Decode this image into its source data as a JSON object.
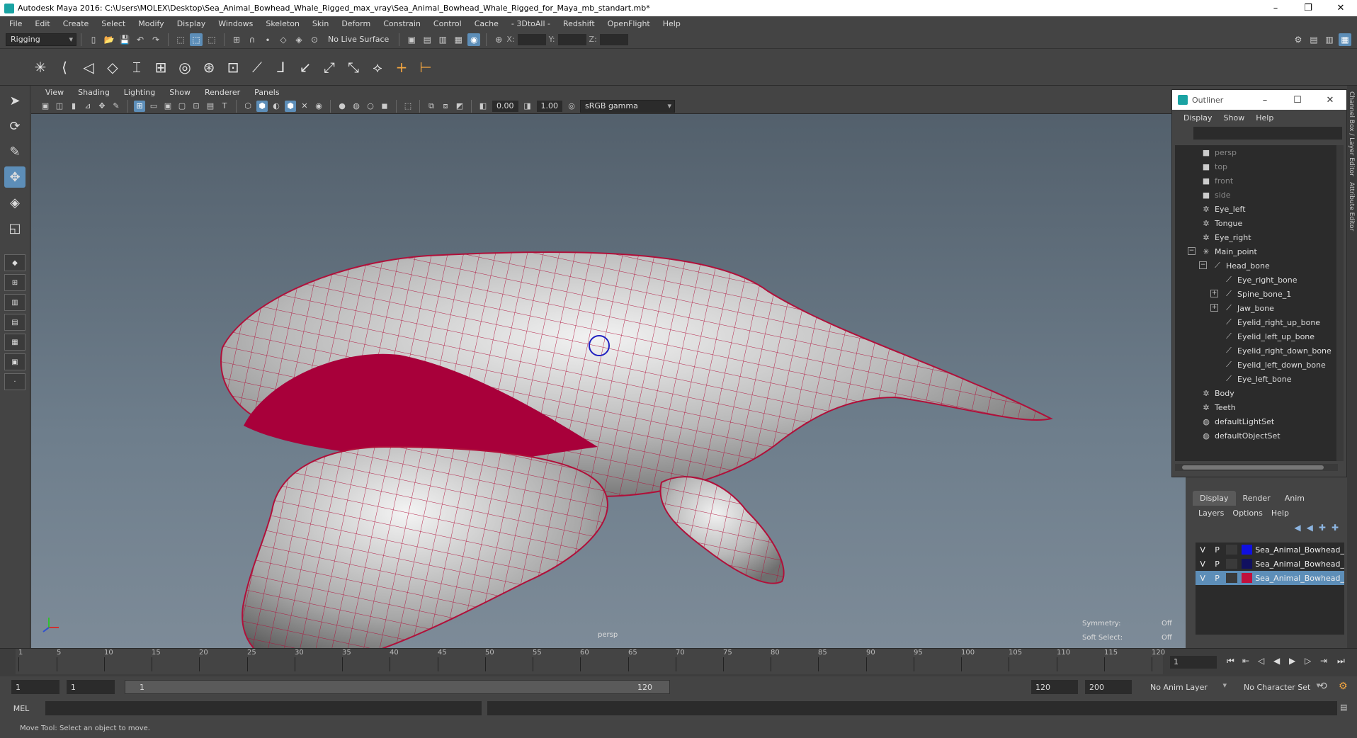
{
  "window": {
    "title": "Autodesk Maya 2016: C:\\Users\\MOLEX\\Desktop\\Sea_Animal_Bowhead_Whale_Rigged_max_vray\\Sea_Animal_Bowhead_Whale_Rigged_for_Maya_mb_standart.mb*",
    "minimize": "–",
    "restore": "❐",
    "close": "✕"
  },
  "menubar": [
    "File",
    "Edit",
    "Create",
    "Select",
    "Modify",
    "Display",
    "Windows",
    "Skeleton",
    "Skin",
    "Deform",
    "Constrain",
    "Control",
    "Cache",
    "- 3DtoAll -",
    "Redshift",
    "OpenFlight",
    "Help"
  ],
  "toolbar": {
    "mode": "Rigging",
    "live_surface": "No Live Surface",
    "x_label": "X:",
    "y_label": "Y:",
    "z_label": "Z:"
  },
  "viewport_menu": [
    "View",
    "Shading",
    "Lighting",
    "Show",
    "Renderer",
    "Panels"
  ],
  "viewport_toolbar": {
    "exposure": "0.00",
    "gamma": "1.00",
    "color_space": "sRGB gamma"
  },
  "viewport": {
    "camera_label": "persp",
    "symmetry_label": "Symmetry:",
    "symmetry_value": "Off",
    "soft_select_label": "Soft Select:",
    "soft_select_value": "Off"
  },
  "outliner": {
    "title": "Outliner",
    "menu": [
      "Display",
      "Show",
      "Help"
    ],
    "items": [
      {
        "label": "persp",
        "icon": "camera-icon",
        "dim": true,
        "indent": 0
      },
      {
        "label": "top",
        "icon": "camera-icon",
        "dim": true,
        "indent": 0
      },
      {
        "label": "front",
        "icon": "camera-icon",
        "dim": true,
        "indent": 0
      },
      {
        "label": "side",
        "icon": "camera-icon",
        "dim": true,
        "indent": 0
      },
      {
        "label": "Eye_left",
        "icon": "mesh-icon",
        "dim": false,
        "indent": 0
      },
      {
        "label": "Tongue",
        "icon": "mesh-icon",
        "dim": false,
        "indent": 0
      },
      {
        "label": "Eye_right",
        "icon": "mesh-icon",
        "dim": false,
        "indent": 0
      },
      {
        "label": "Main_point",
        "icon": "joint-star-icon",
        "dim": false,
        "indent": 0,
        "expander": "−"
      },
      {
        "label": "Head_bone",
        "icon": "bone-icon",
        "dim": false,
        "indent": 1,
        "expander": "−"
      },
      {
        "label": "Eye_right_bone",
        "icon": "bone-icon",
        "dim": false,
        "indent": 2
      },
      {
        "label": "Spine_bone_1",
        "icon": "bone-icon",
        "dim": false,
        "indent": 2,
        "expander": "+"
      },
      {
        "label": "Jaw_bone",
        "icon": "bone-icon",
        "dim": false,
        "indent": 2,
        "expander": "+"
      },
      {
        "label": "Eyelid_right_up_bone",
        "icon": "bone-icon",
        "dim": false,
        "indent": 2
      },
      {
        "label": "Eyelid_left_up_bone",
        "icon": "bone-icon",
        "dim": false,
        "indent": 2
      },
      {
        "label": "Eyelid_right_down_bone",
        "icon": "bone-icon",
        "dim": false,
        "indent": 2
      },
      {
        "label": "Eyelid_left_down_bone",
        "icon": "bone-icon",
        "dim": false,
        "indent": 2
      },
      {
        "label": "Eye_left_bone",
        "icon": "bone-icon",
        "dim": false,
        "indent": 2
      },
      {
        "label": "Body",
        "icon": "mesh-icon",
        "dim": false,
        "indent": 0
      },
      {
        "label": "Teeth",
        "icon": "mesh-icon",
        "dim": false,
        "indent": 0
      },
      {
        "label": "defaultLightSet",
        "icon": "set-icon",
        "dim": false,
        "indent": 0
      },
      {
        "label": "defaultObjectSet",
        "icon": "set-icon",
        "dim": false,
        "indent": 0
      }
    ]
  },
  "right_strip": {
    "channel_box": "Channel Box / Layer Editor",
    "attribute_editor": "Attribute Editor"
  },
  "layer_editor": {
    "tabs": [
      "Display",
      "Render",
      "Anim"
    ],
    "menu": [
      "Layers",
      "Options",
      "Help"
    ],
    "layers": [
      {
        "v": "V",
        "p": "P",
        "color": "#1010e0",
        "name": "Sea_Animal_Bowhead_",
        "selected": false
      },
      {
        "v": "V",
        "p": "P",
        "color": "#101060",
        "name": "Sea_Animal_Bowhead_",
        "selected": false
      },
      {
        "v": "V",
        "p": "P",
        "color": "#c0103c",
        "name": "Sea_Animal_Bowhead_",
        "selected": true
      }
    ]
  },
  "timeline": {
    "ticks": [
      "1",
      "5",
      "10",
      "15",
      "20",
      "25",
      "30",
      "35",
      "40",
      "45",
      "50",
      "55",
      "60",
      "65",
      "70",
      "75",
      "80",
      "85",
      "90",
      "95",
      "100",
      "105",
      "110",
      "115",
      "120"
    ],
    "current_frame": "1"
  },
  "range": {
    "start": "1",
    "playback_start": "1",
    "slider_start": "1",
    "slider_end": "120",
    "playback_end": "120",
    "end": "200",
    "anim_layer": "No Anim Layer",
    "character_set": "No Character Set"
  },
  "command": {
    "label": "MEL"
  },
  "help_line": "Move Tool: Select an object to move.",
  "colors": {
    "wire": "#b0103a",
    "selected": "#5d8eb8"
  }
}
